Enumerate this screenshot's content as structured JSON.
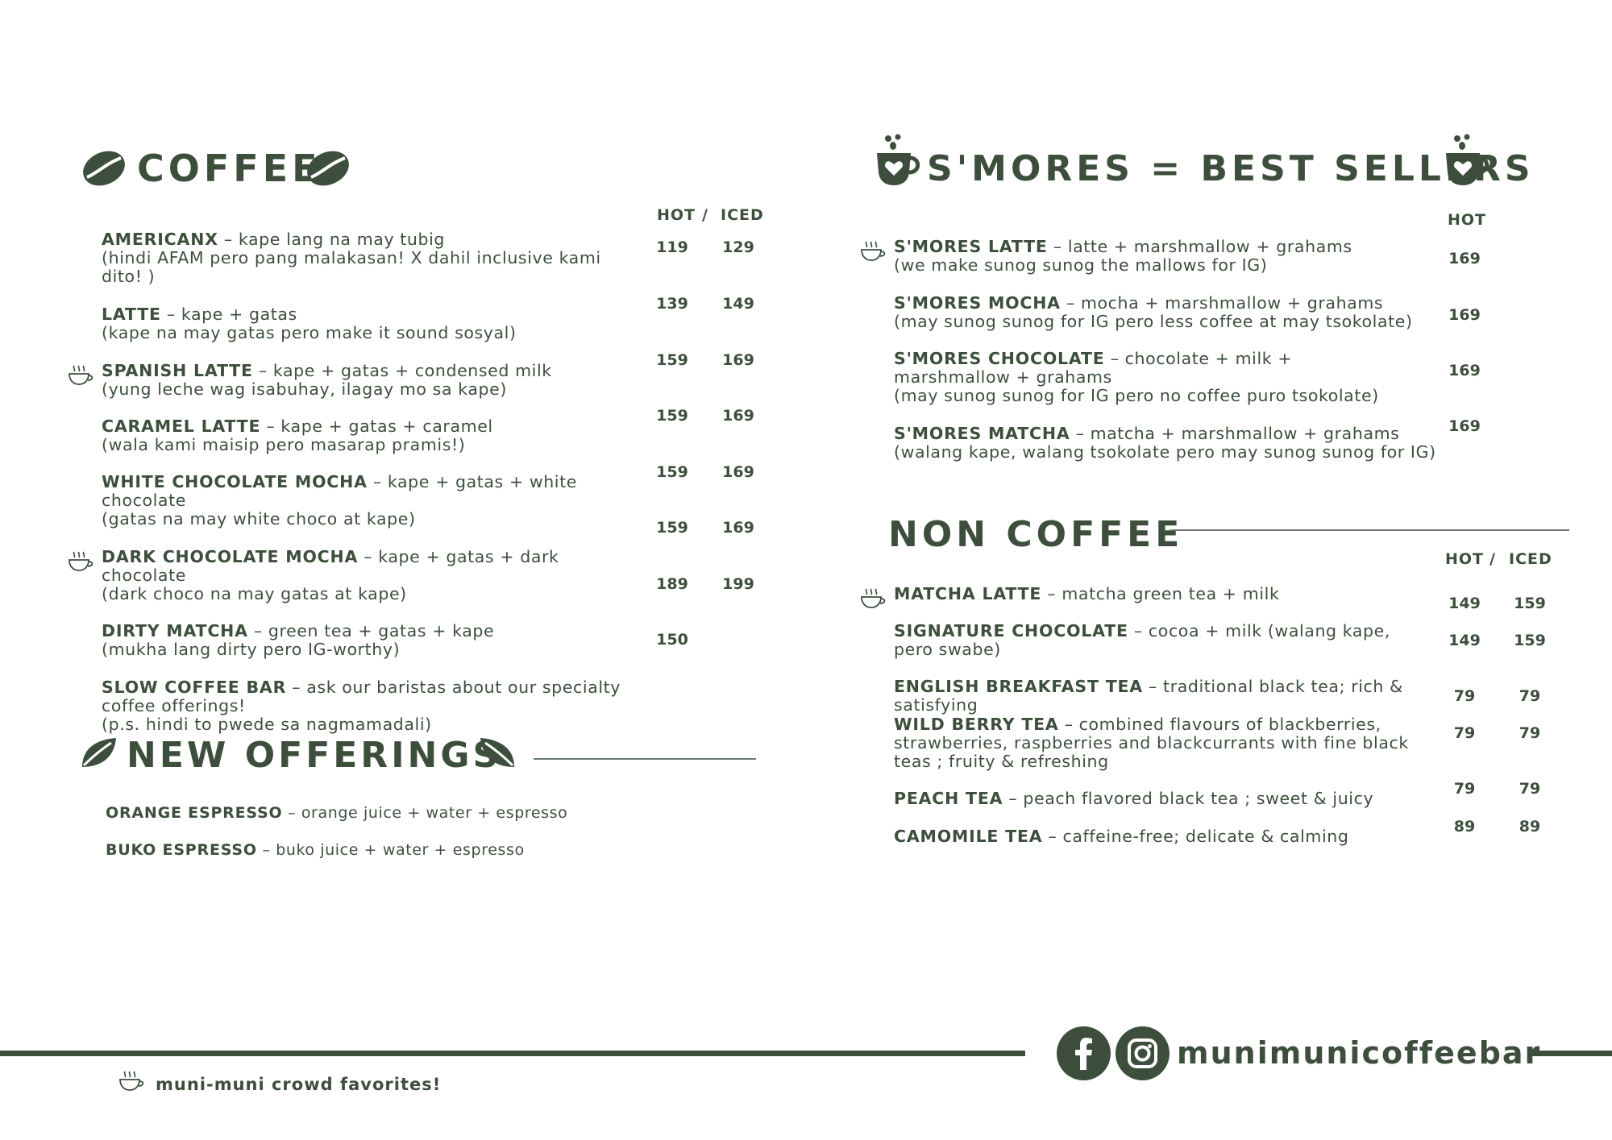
{
  "coffee": {
    "title": "COFFEE",
    "col_hot": "HOT",
    "col_sep": "/",
    "col_iced": "ICED",
    "items": [
      {
        "name": "AMERICANX",
        "desc": " – kape lang na may tubig",
        "note": "(hindi AFAM pero pang malakasan! X dahil inclusive kami dito! )",
        "hot": "119",
        "iced": "129",
        "favorite": false
      },
      {
        "name": "LATTE",
        "desc": " – kape + gatas",
        "note": "(kape na may gatas pero make it sound sosyal)",
        "hot": "139",
        "iced": "149",
        "favorite": false
      },
      {
        "name": "SPANISH LATTE",
        "desc": " – kape + gatas + condensed milk",
        "note": "(yung leche wag isabuhay, ilagay mo sa kape)",
        "hot": "159",
        "iced": "169",
        "favorite": true
      },
      {
        "name": "CARAMEL LATTE",
        "desc": " – kape + gatas + caramel",
        "note": "(wala kami maisip pero masarap pramis!)",
        "hot": "159",
        "iced": "169",
        "favorite": false
      },
      {
        "name": "WHITE CHOCOLATE MOCHA",
        "desc": " – kape + gatas + white chocolate",
        "note": "(gatas na may white choco at kape)",
        "hot": "159",
        "iced": "169",
        "favorite": false
      },
      {
        "name": "DARK CHOCOLATE MOCHA",
        "desc": " – kape + gatas + dark chocolate",
        "note": "(dark choco na may gatas at kape)",
        "hot": "159",
        "iced": "169",
        "favorite": true
      },
      {
        "name": "DIRTY MATCHA",
        "desc": " – green tea + gatas + kape",
        "note": "(mukha lang dirty pero IG-worthy)",
        "hot": "189",
        "iced": "199",
        "favorite": false
      },
      {
        "name": "SLOW COFFEE BAR",
        "desc": " – ask our baristas about our specialty coffee offerings!",
        "note": "(p.s. hindi to pwede sa nagmamadali)",
        "hot": "150",
        "iced": "",
        "favorite": false
      }
    ]
  },
  "new_offerings": {
    "title": "NEW OFFERINGS",
    "items": [
      {
        "name": "ORANGE ESPRESSO",
        "desc": " – orange juice + water + espresso"
      },
      {
        "name": "BUKO ESPRESSO",
        "desc": " – buko juice + water + espresso"
      }
    ]
  },
  "smores": {
    "title": "S'MORES = BEST SELLERS",
    "col_hot": "HOT",
    "items": [
      {
        "name": "S'MORES LATTE",
        "desc": " – latte + marshmallow + grahams",
        "note": "(we make sunog sunog the mallows for IG)",
        "hot": "169",
        "favorite": true
      },
      {
        "name": "S'MORES MOCHA",
        "desc": " – mocha + marshmallow + grahams",
        "note": "(may sunog sunog for IG pero less coffee at may tsokolate)",
        "hot": "169",
        "favorite": false
      },
      {
        "name": "S'MORES CHOCOLATE",
        "desc": " – chocolate + milk + marshmallow + grahams",
        "note": "(may sunog sunog for IG pero no coffee puro tsokolate)",
        "hot": "169",
        "favorite": false
      },
      {
        "name": "S'MORES MATCHA",
        "desc": " – matcha + marshmallow + grahams",
        "note": "(walang kape, walang tsokolate pero may sunog sunog for IG)",
        "hot": "169",
        "favorite": false
      }
    ]
  },
  "non_coffee": {
    "title": "NON COFFEE",
    "col_hot": "HOT",
    "col_sep": "/",
    "col_iced": "ICED",
    "items": [
      {
        "name": "MATCHA LATTE",
        "desc": " – matcha green tea + milk",
        "hot": "149",
        "iced": "159",
        "favorite": true
      },
      {
        "name": "SIGNATURE CHOCOLATE",
        "desc": " – cocoa + milk (walang kape, pero swabe)",
        "hot": "149",
        "iced": "159",
        "favorite": false
      },
      {
        "name": "ENGLISH BREAKFAST TEA",
        "desc": " – traditional black tea; rich & satisfying",
        "hot": "79",
        "iced": "79",
        "favorite": false
      },
      {
        "name": "WILD BERRY TEA",
        "desc": " – combined flavours of blackberries, strawberries, raspberries and blackcurrants with fine black teas ; fruity & refreshing",
        "hot": "79",
        "iced": "79",
        "favorite": false
      },
      {
        "name": "PEACH TEA",
        "desc": " – peach flavored black tea ; sweet & juicy",
        "hot": "79",
        "iced": "79",
        "favorite": false
      },
      {
        "name": "CAMOMILE TEA",
        "desc": " – caffeine-free; delicate & calming",
        "hot": "89",
        "iced": "89",
        "favorite": false
      }
    ]
  },
  "footer": {
    "legend": "muni-muni crowd favorites!",
    "handle": "munimunicoffeebar"
  },
  "colors": {
    "brand": "#3d4f3c",
    "background": "#ffffff"
  }
}
